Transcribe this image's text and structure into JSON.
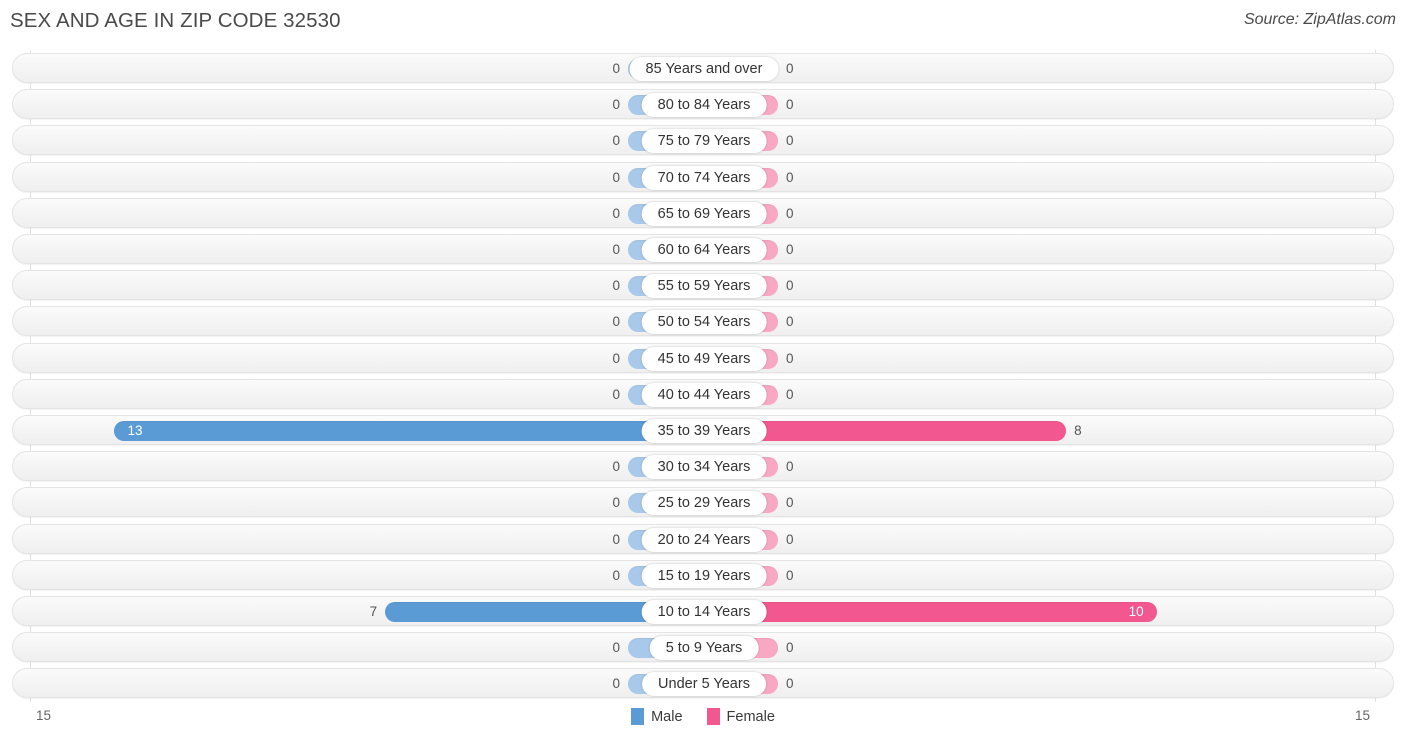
{
  "header": {
    "title": "SEX AND AGE IN ZIP CODE 32530",
    "source": "Source: ZipAtlas.com"
  },
  "legend": {
    "male_label": "Male",
    "female_label": "Female",
    "male_color": "#5b9bd5",
    "female_color": "#f2588f"
  },
  "axis": {
    "left_tick": "15",
    "right_tick": "15",
    "max": 15
  },
  "chart_data": {
    "type": "bar",
    "orientation": "horizontal-diverging",
    "title": "SEX AND AGE IN ZIP CODE 32530",
    "xlabel": "",
    "ylabel": "",
    "xlim": [
      -15,
      15
    ],
    "grid": true,
    "legend_position": "bottom-center",
    "categories": [
      "85 Years and over",
      "80 to 84 Years",
      "75 to 79 Years",
      "70 to 74 Years",
      "65 to 69 Years",
      "60 to 64 Years",
      "55 to 59 Years",
      "50 to 54 Years",
      "45 to 49 Years",
      "40 to 44 Years",
      "35 to 39 Years",
      "30 to 34 Years",
      "25 to 29 Years",
      "20 to 24 Years",
      "15 to 19 Years",
      "10 to 14 Years",
      "5 to 9 Years",
      "Under 5 Years"
    ],
    "series": [
      {
        "name": "Male",
        "values": [
          0,
          0,
          0,
          0,
          0,
          0,
          0,
          0,
          0,
          0,
          13,
          0,
          0,
          0,
          0,
          7,
          0,
          0
        ]
      },
      {
        "name": "Female",
        "values": [
          0,
          0,
          0,
          0,
          0,
          0,
          0,
          0,
          0,
          0,
          8,
          0,
          0,
          0,
          0,
          10,
          0,
          0
        ]
      }
    ]
  },
  "rows": [
    {
      "label": "85 Years and over",
      "male": "0",
      "female": "0"
    },
    {
      "label": "80 to 84 Years",
      "male": "0",
      "female": "0"
    },
    {
      "label": "75 to 79 Years",
      "male": "0",
      "female": "0"
    },
    {
      "label": "70 to 74 Years",
      "male": "0",
      "female": "0"
    },
    {
      "label": "65 to 69 Years",
      "male": "0",
      "female": "0"
    },
    {
      "label": "60 to 64 Years",
      "male": "0",
      "female": "0"
    },
    {
      "label": "55 to 59 Years",
      "male": "0",
      "female": "0"
    },
    {
      "label": "50 to 54 Years",
      "male": "0",
      "female": "0"
    },
    {
      "label": "45 to 49 Years",
      "male": "0",
      "female": "0"
    },
    {
      "label": "40 to 44 Years",
      "male": "0",
      "female": "0"
    },
    {
      "label": "35 to 39 Years",
      "male": "13",
      "female": "8"
    },
    {
      "label": "30 to 34 Years",
      "male": "0",
      "female": "0"
    },
    {
      "label": "25 to 29 Years",
      "male": "0",
      "female": "0"
    },
    {
      "label": "20 to 24 Years",
      "male": "0",
      "female": "0"
    },
    {
      "label": "15 to 19 Years",
      "male": "0",
      "female": "0"
    },
    {
      "label": "10 to 14 Years",
      "male": "7",
      "female": "10"
    },
    {
      "label": "5 to 9 Years",
      "male": "0",
      "female": "0"
    },
    {
      "label": "Under 5 Years",
      "male": "0",
      "female": "0"
    }
  ]
}
